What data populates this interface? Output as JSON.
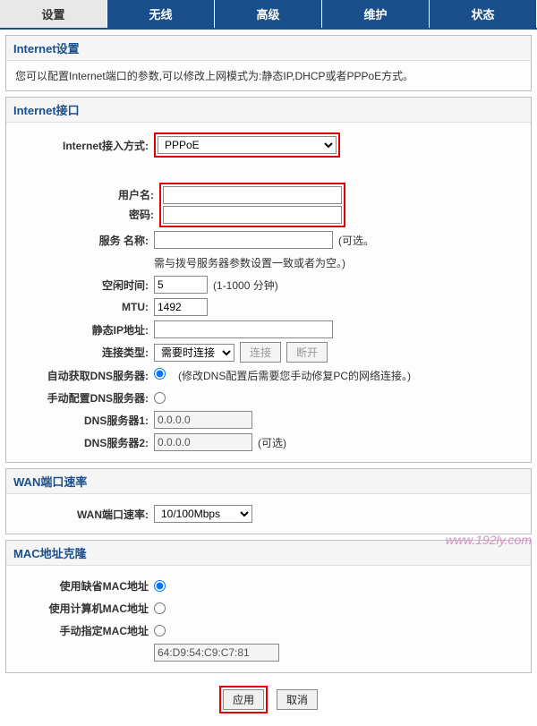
{
  "tabs": {
    "settings": "设置",
    "wireless": "无线",
    "advanced": "高级",
    "maintenance": "维护",
    "status": "状态"
  },
  "internet_settings": {
    "title": "Internet设置",
    "desc": "您可以配置Internet端口的参数,可以修改上网模式为:静态IP,DHCP或者PPPoE方式。"
  },
  "internet_interface": {
    "title": "Internet接口",
    "labels": {
      "access": "Internet接入方式:",
      "username": "用户名:",
      "password": "密码:",
      "service": "服务 名称:",
      "idle": "空闲时间:",
      "mtu": "MTU:",
      "static_ip": "静态IP地址:",
      "conn_type": "连接类型:",
      "auto_dns": "自动获取DNS服务器:",
      "manual_dns": "手动配置DNS服务器:",
      "dns1": "DNS服务器1:",
      "dns2": "DNS服务器2:"
    },
    "access_value": "PPPoE",
    "username_value": "",
    "password_value": "",
    "service_hint_right": "(可选。",
    "service_hint_below": "需与拨号服务器参数设置一致或者为空。)",
    "idle_value": "5",
    "idle_hint": "(1-1000 分钟)",
    "mtu_value": "1492",
    "conn_type_value": "需要时连接",
    "connect_btn": "连接",
    "disconnect_btn": "断开",
    "dns_note": "(修改DNS配置后需要您手动修复PC的网络连接。)",
    "dns1_value": "0.0.0.0",
    "dns2_value": "0.0.0.0",
    "dns2_hint": "(可选)"
  },
  "wan_rate": {
    "title": "WAN端口速率",
    "label": "WAN端口速率:",
    "value": "10/100Mbps"
  },
  "mac_clone": {
    "title": "MAC地址克隆",
    "labels": {
      "default": "使用缺省MAC地址",
      "pc": "使用计算机MAC地址",
      "manual": "手动指定MAC地址"
    },
    "mac_value": "64:D9:54:C9:C7:81"
  },
  "footer": {
    "apply": "应用",
    "cancel": "取消"
  },
  "watermark": "www.192ly.com"
}
